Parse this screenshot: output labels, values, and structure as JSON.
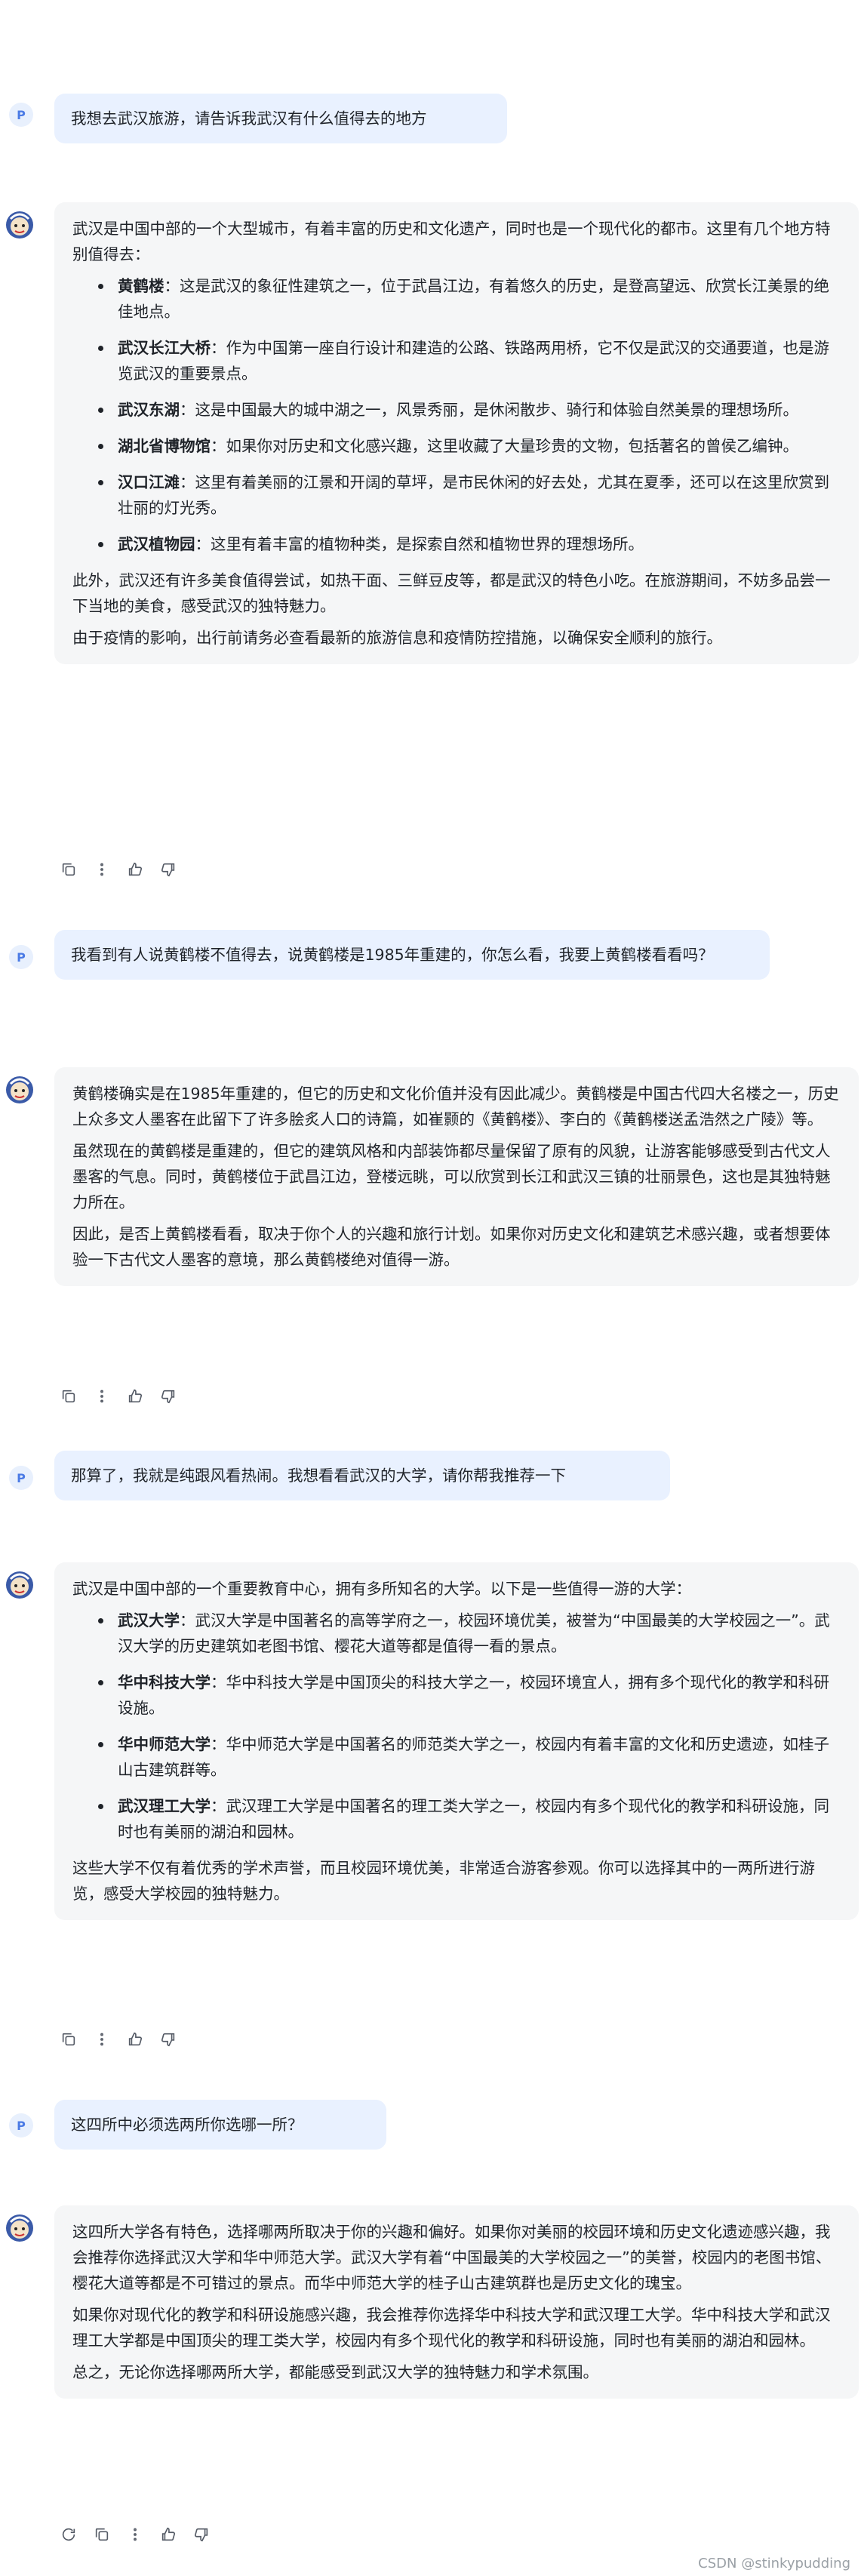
{
  "messages": [
    {
      "role": "user",
      "avatar": "P",
      "text": "我想去武汉旅游，请告诉我武汉有什么值得去的地方"
    },
    {
      "role": "assistant",
      "intro": "武汉是中国中部的一个大型城市，有着丰富的历史和文化遗产，同时也是一个现代化的都市。这里有几个地方特别值得去：",
      "items": [
        {
          "name": "黄鹤楼",
          "desc": "：这是武汉的象征性建筑之一，位于武昌江边，有着悠久的历史，是登高望远、欣赏长江美景的绝佳地点。"
        },
        {
          "name": "武汉长江大桥",
          "desc": "：作为中国第一座自行设计和建造的公路、铁路两用桥，它不仅是武汉的交通要道，也是游览武汉的重要景点。"
        },
        {
          "name": "武汉东湖",
          "desc": "：这是中国最大的城中湖之一，风景秀丽，是休闲散步、骑行和体验自然美景的理想场所。"
        },
        {
          "name": "湖北省博物馆",
          "desc": "：如果你对历史和文化感兴趣，这里收藏了大量珍贵的文物，包括著名的曾侯乙编钟。"
        },
        {
          "name": "汉口江滩",
          "desc": "：这里有着美丽的江景和开阔的草坪，是市民休闲的好去处，尤其在夏季，还可以在这里欣赏到壮丽的灯光秀。"
        },
        {
          "name": "武汉植物园",
          "desc": "：这里有着丰富的植物种类，是探索自然和植物世界的理想场所。"
        }
      ],
      "after": [
        "此外，武汉还有许多美食值得尝试，如热干面、三鲜豆皮等，都是武汉的特色小吃。在旅游期间，不妨多品尝一下当地的美食，感受武汉的独特魅力。",
        "由于疫情的影响，出行前请务必查看最新的旅游信息和疫情防控措施，以确保安全顺利的旅行。"
      ]
    },
    {
      "role": "user",
      "avatar": "P",
      "text": "我看到有人说黄鹤楼不值得去，说黄鹤楼是1985年重建的，你怎么看，我要上黄鹤楼看看吗？"
    },
    {
      "role": "assistant",
      "paragraphs": [
        "黄鹤楼确实是在1985年重建的，但它的历史和文化价值并没有因此减少。黄鹤楼是中国古代四大名楼之一，历史上众多文人墨客在此留下了许多脍炙人口的诗篇，如崔颢的《黄鹤楼》、李白的《黄鹤楼送孟浩然之广陵》等。",
        "虽然现在的黄鹤楼是重建的，但它的建筑风格和内部装饰都尽量保留了原有的风貌，让游客能够感受到古代文人墨客的气息。同时，黄鹤楼位于武昌江边，登楼远眺，可以欣赏到长江和武汉三镇的壮丽景色，这也是其独特魅力所在。",
        "因此，是否上黄鹤楼看看，取决于你个人的兴趣和旅行计划。如果你对历史文化和建筑艺术感兴趣，或者想要体验一下古代文人墨客的意境，那么黄鹤楼绝对值得一游。"
      ]
    },
    {
      "role": "user",
      "avatar": "P",
      "text": "那算了，我就是纯跟风看热闹。我想看看武汉的大学，请你帮我推荐一下"
    },
    {
      "role": "assistant",
      "intro": "武汉是中国中部的一个重要教育中心，拥有多所知名的大学。以下是一些值得一游的大学：",
      "items": [
        {
          "name": "武汉大学",
          "desc": "：武汉大学是中国著名的高等学府之一，校园环境优美，被誉为“中国最美的大学校园之一”。武汉大学的历史建筑如老图书馆、樱花大道等都是值得一看的景点。"
        },
        {
          "name": "华中科技大学",
          "desc": "：华中科技大学是中国顶尖的科技大学之一，校园环境宜人，拥有多个现代化的教学和科研设施。"
        },
        {
          "name": "华中师范大学",
          "desc": "：华中师范大学是中国著名的师范类大学之一，校园内有着丰富的文化和历史遗迹，如桂子山古建筑群等。"
        },
        {
          "name": "武汉理工大学",
          "desc": "：武汉理工大学是中国著名的理工类大学之一，校园内有多个现代化的教学和科研设施，同时也有美丽的湖泊和园林。"
        }
      ],
      "after": [
        "这些大学不仅有着优秀的学术声誉，而且校园环境优美，非常适合游客参观。你可以选择其中的一两所进行游览，感受大学校园的独特魅力。"
      ]
    },
    {
      "role": "user",
      "avatar": "P",
      "text": "这四所中必须选两所你选哪一所？"
    },
    {
      "role": "assistant",
      "paragraphs": [
        "这四所大学各有特色，选择哪两所取决于你的兴趣和偏好。如果你对美丽的校园环境和历史文化遗迹感兴趣，我会推荐你选择武汉大学和华中师范大学。武汉大学有着“中国最美的大学校园之一”的美誉，校园内的老图书馆、樱花大道等都是不可错过的景点。而华中师范大学的桂子山古建筑群也是历史文化的瑰宝。",
        "如果你对现代化的教学和科研设施感兴趣，我会推荐你选择华中科技大学和武汉理工大学。华中科技大学和武汉理工大学都是中国顶尖的理工类大学，校园内有多个现代化的教学和科研设施，同时也有美丽的湖泊和园林。",
        "总之，无论你选择哪两所大学，都能感受到武汉大学的独特魅力和学术氛围。"
      ]
    }
  ],
  "watermark": "CSDN @stinkypudding"
}
